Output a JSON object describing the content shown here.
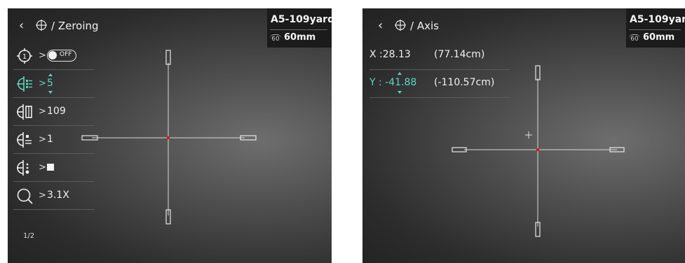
{
  "left": {
    "header": {
      "back_icon": "chevron-left-icon",
      "target_icon": "crosshair-circle-icon",
      "title": "/ Zeroing"
    },
    "info": {
      "profile": "A5-109yard",
      "lens_icon": "lens-icon",
      "lens_icon_text": "60",
      "focal": "60mm"
    },
    "menu": [
      {
        "icon": "zero-profile-icon",
        "arrow": ">",
        "toggle_label": "OFF",
        "toggle_state": "off"
      },
      {
        "icon": "reticle-style-icon",
        "arrow": ">",
        "value": "5",
        "active": true
      },
      {
        "icon": "distance-icon",
        "arrow": ">",
        "value": "109"
      },
      {
        "icon": "reticle-color-icon",
        "arrow": ">",
        "value": "1"
      },
      {
        "icon": "reticle-dot-icon",
        "arrow": ">",
        "value": "■"
      },
      {
        "icon": "zoom-icon",
        "arrow": ">",
        "value": "3.1X"
      }
    ],
    "page": "1/2"
  },
  "right": {
    "header": {
      "back_icon": "chevron-left-icon",
      "target_icon": "crosshair-circle-icon",
      "title": "/ Axis"
    },
    "info": {
      "profile": "A5-109yard",
      "lens_icon": "lens-icon",
      "lens_icon_text": "60",
      "focal": "60mm"
    },
    "axis": {
      "x_label": "X :28.13",
      "x_cm": "(77.14cm)",
      "y_label": "Y : -41.88",
      "y_cm": "(-110.57cm)"
    }
  },
  "colors": {
    "accent": "#5fd3c2",
    "reticle_center": "#c42020",
    "panel_bg": "#3a3a3a"
  }
}
